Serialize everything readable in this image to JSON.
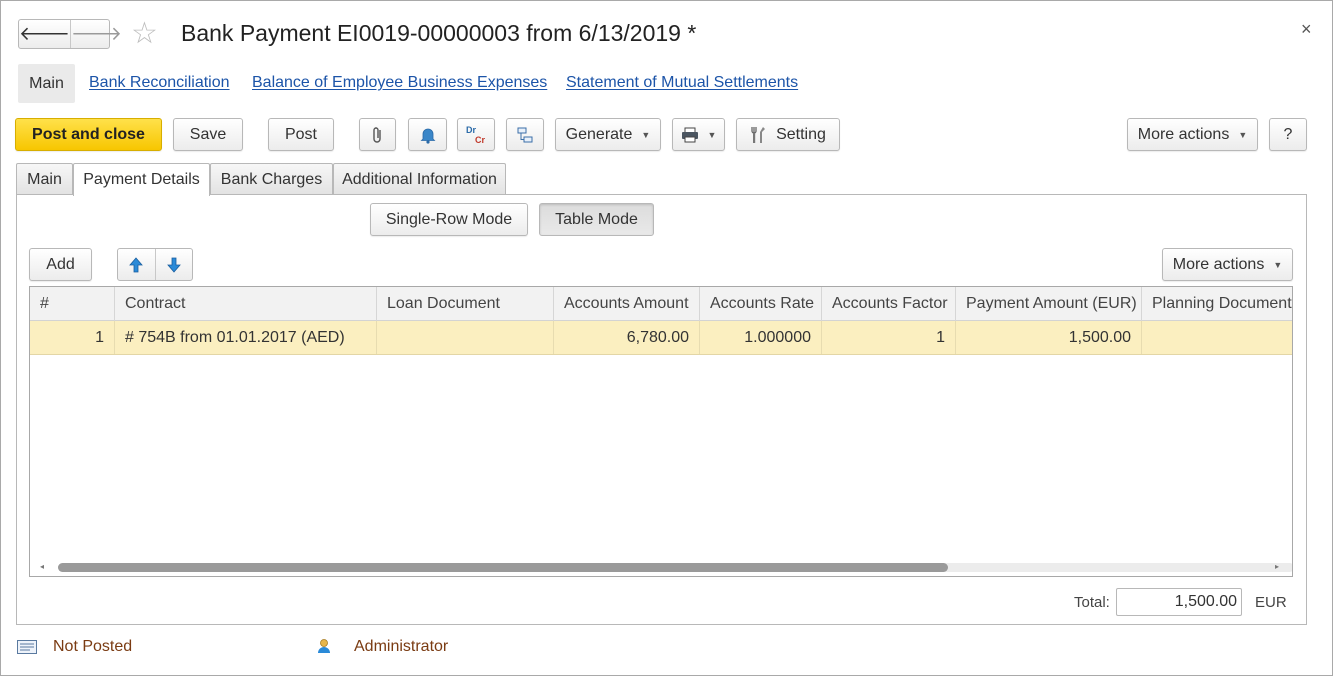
{
  "window": {
    "title": "Bank Payment EI0019-00000003 from 6/13/2019 *",
    "close_label": "×"
  },
  "nav": {
    "back_glyph": "🡐",
    "forward_glyph": "🡒",
    "main_label": "Main",
    "links": [
      "Bank Reconciliation",
      "Balance of Employee Business Expenses",
      "Statement of Mutual Settlements"
    ]
  },
  "toolbar": {
    "post_close_label": "Post and close",
    "save_label": "Save",
    "post_label": "Post",
    "dr_label": "Dr",
    "cr_label": "Cr",
    "generate_label": "Generate",
    "setting_label": "Setting",
    "more_actions_label": "More actions",
    "help_label": "?"
  },
  "tabs": [
    "Main",
    "Payment Details",
    "Bank Charges",
    "Additional Information"
  ],
  "active_tab": "Payment Details",
  "mode": {
    "single_row_label": "Single-Row Mode",
    "table_label": "Table Mode"
  },
  "grid_toolbar": {
    "add_label": "Add",
    "more_actions_label": "More actions"
  },
  "table": {
    "columns": [
      "#",
      "Contract",
      "Loan Document",
      "Accounts Amount",
      "Accounts Rate",
      "Accounts Factor",
      "Payment Amount (EUR)",
      "Planning Document"
    ],
    "rows": [
      [
        "1",
        "# 754B from 01.01.2017 (AED)",
        "",
        "6,780.00",
        "1.000000",
        "1",
        "1,500.00",
        ""
      ]
    ],
    "horizontal_scroll_fraction": 0.72
  },
  "footer": {
    "total_label": "Total:",
    "total_value": "1,500.00",
    "currency": "EUR"
  },
  "status": {
    "posting_status": "Not Posted",
    "user": "Administrator"
  },
  "colors": {
    "primary_button": "#f7c600",
    "link": "#1c54a8",
    "selected_row": "#fbefc0",
    "status_text": "#7a3b12",
    "arrow_blue": "#2a8ad8"
  }
}
